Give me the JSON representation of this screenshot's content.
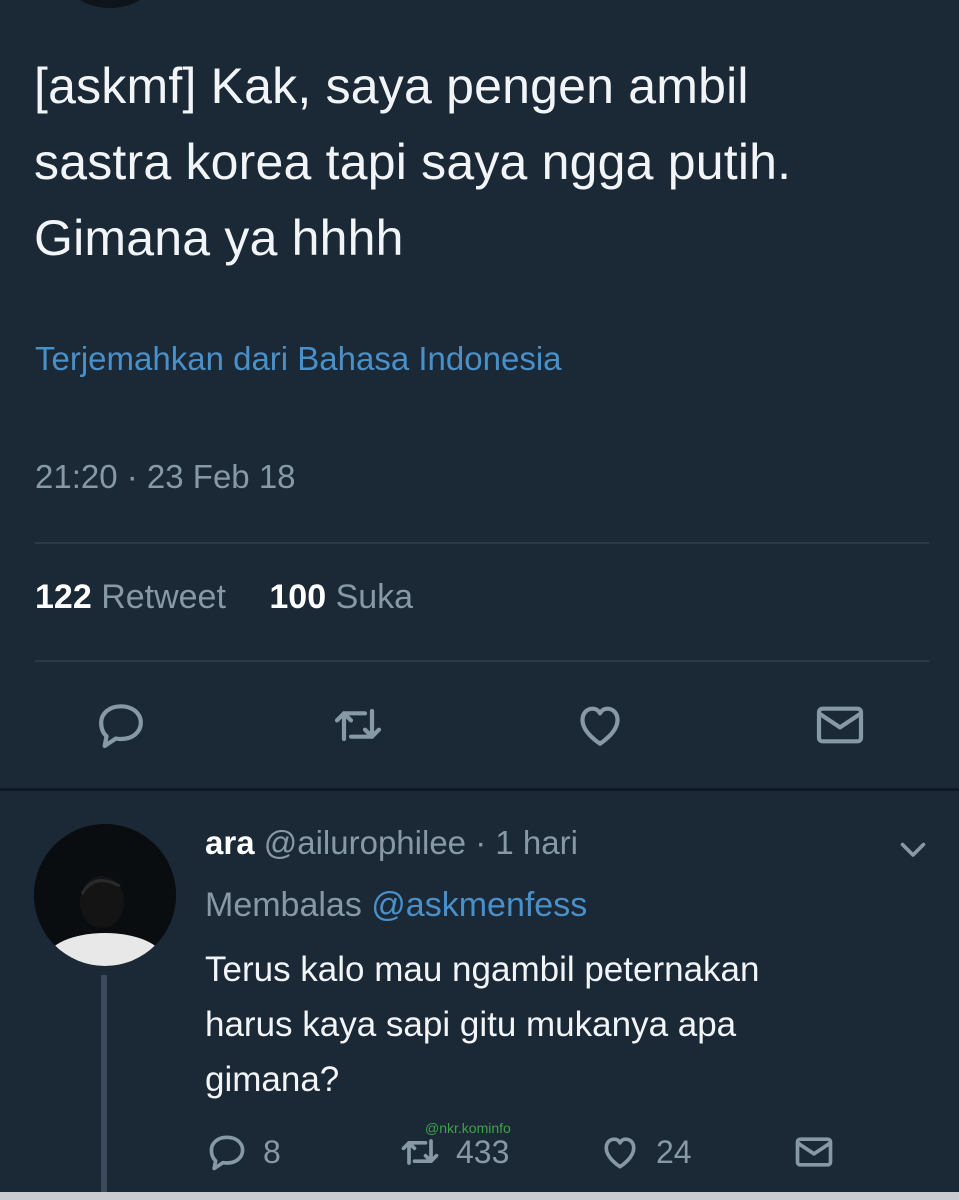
{
  "tweet": {
    "lines": [
      "[askmf] Kak, saya pengen ambil",
      "sastra korea tapi saya ngga putih.",
      "Gimana ya hhhh"
    ],
    "translate_link": "Terjemahkan dari Bahasa Indonesia",
    "timestamp": "21:20 · 23 Feb 18",
    "retweet_count": "122",
    "retweet_label": "Retweet",
    "like_count": "100",
    "like_label": "Suka",
    "actions": [
      "reply-icon",
      "retweet-icon",
      "heart-icon",
      "mail-icon"
    ]
  },
  "reply": {
    "name": "ara",
    "handle": "@ailurophilee",
    "time": "· 1 hari",
    "replying_to_label": "Membalas",
    "replying_to_handle": "@askmenfess",
    "lines": [
      "Terus kalo mau ngambil peternakan",
      "harus kaya sapi gitu mukanya apa",
      "gimana?"
    ],
    "reply_count": "8",
    "retweet_count": "433",
    "like_count": "24"
  },
  "watermark": "@nkr.kominfo",
  "colors": {
    "background": "#1b2836",
    "link": "#4a90c8",
    "muted": "#8899a6"
  }
}
